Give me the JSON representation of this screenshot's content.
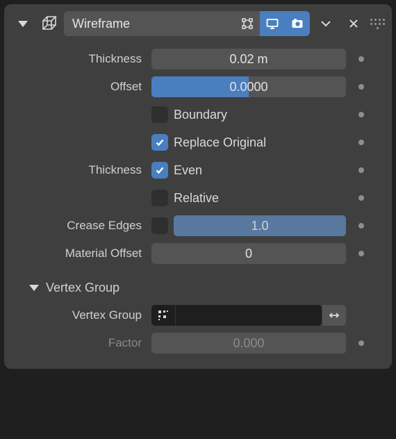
{
  "header": {
    "name": "Wireframe",
    "show_in_editmode": false,
    "show_realtime": true,
    "show_render": true
  },
  "fields": {
    "thickness_label": "Thickness",
    "thickness_value": "0.02 m",
    "offset_label": "Offset",
    "offset_value": "0.0000",
    "offset_fill_pct": 50,
    "boundary_label": "Boundary",
    "boundary_checked": false,
    "replace_label": "Replace Original",
    "replace_checked": true,
    "thickness2_label": "Thickness",
    "even_label": "Even",
    "even_checked": true,
    "relative_label": "Relative",
    "relative_checked": false,
    "crease_label": "Crease Edges",
    "crease_checked": false,
    "crease_value": "1.0",
    "material_offset_label": "Material Offset",
    "material_offset_value": "0"
  },
  "vertex_group": {
    "section_label": "Vertex Group",
    "field_label": "Vertex Group",
    "value": "",
    "factor_label": "Factor",
    "factor_value": "0.000"
  }
}
